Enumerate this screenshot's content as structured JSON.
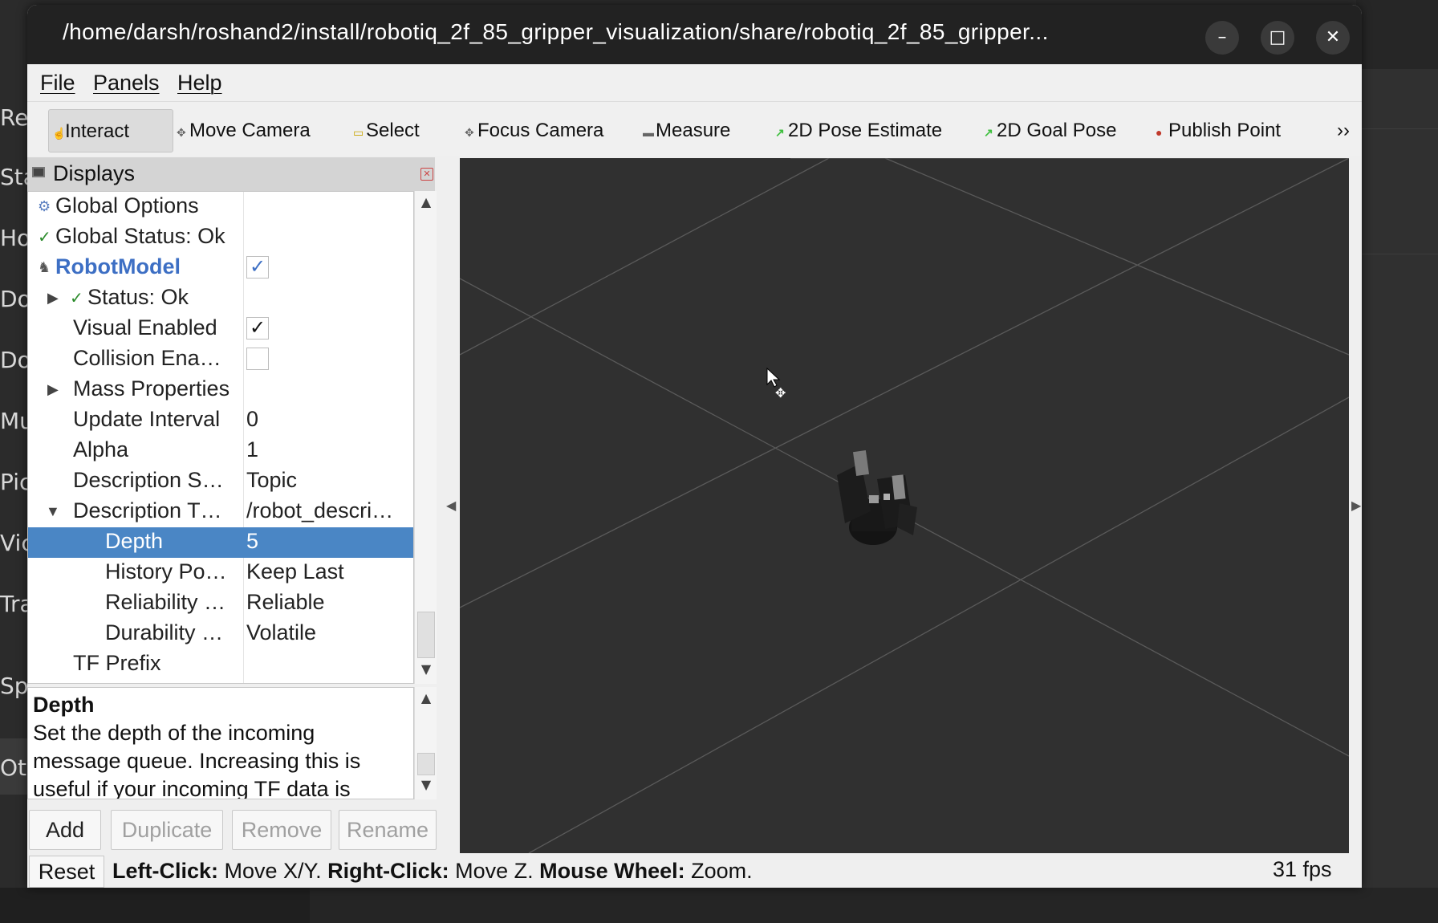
{
  "background_app": {
    "left_items": [
      "Re",
      "Sta",
      "Ho",
      "Do",
      "Do",
      "Mu",
      "Pic",
      "Vic",
      "Tra",
      "Spi",
      "Ot"
    ]
  },
  "window": {
    "title": "/home/darsh/roshand2/install/robotiq_2f_85_gripper_visualization/share/robotiq_2f_85_gripper...",
    "minimize_glyph": "–",
    "maximize_glyph": "□",
    "close_glyph": "✕"
  },
  "menu": {
    "file": "File",
    "panels": "Panels",
    "help": "Help"
  },
  "toolbar": {
    "interact": "Interact",
    "move_camera": "Move Camera",
    "select": "Select",
    "focus_camera": "Focus Camera",
    "measure": "Measure",
    "pose_estimate": "2D Pose Estimate",
    "goal_pose": "2D Goal Pose",
    "publish_point": "Publish Point",
    "more": "››"
  },
  "displays": {
    "title": "Displays",
    "rows": [
      {
        "label": "Global Options",
        "value": ""
      },
      {
        "label": "Global Status: Ok",
        "value": ""
      },
      {
        "label": "RobotModel",
        "value": ""
      },
      {
        "label": "Status: Ok",
        "value": ""
      },
      {
        "label": "Visual Enabled",
        "value": ""
      },
      {
        "label": "Collision Ena…",
        "value": ""
      },
      {
        "label": "Mass Properties",
        "value": ""
      },
      {
        "label": "Update Interval",
        "value": "0"
      },
      {
        "label": "Alpha",
        "value": "1"
      },
      {
        "label": "Description S…",
        "value": "Topic"
      },
      {
        "label": "Description T…",
        "value": "/robot_descri…"
      },
      {
        "label": "Depth",
        "value": "5"
      },
      {
        "label": "History Po…",
        "value": "Keep Last"
      },
      {
        "label": "Reliability …",
        "value": "Reliable"
      },
      {
        "label": "Durability …",
        "value": "Volatile"
      },
      {
        "label": "TF Prefix",
        "value": ""
      }
    ],
    "checks": {
      "robotmodel": "✓",
      "visual": "✓",
      "collision": ""
    }
  },
  "help_panel": {
    "heading": "Depth",
    "text": "Set the depth of the incoming message queue. Increasing this is useful if your incoming TF data is"
  },
  "buttons": {
    "add": "Add",
    "duplicate": "Duplicate",
    "remove": "Remove",
    "rename": "Rename"
  },
  "statusbar": {
    "reset": "Reset",
    "left_click": "Left-Click:",
    "left_click_desc": " Move X/Y. ",
    "right_click": "Right-Click:",
    "right_click_desc": " Move Z. ",
    "mouse_wheel": "Mouse Wheel:",
    "mouse_wheel_desc": " Zoom.",
    "fps": "31 fps"
  }
}
